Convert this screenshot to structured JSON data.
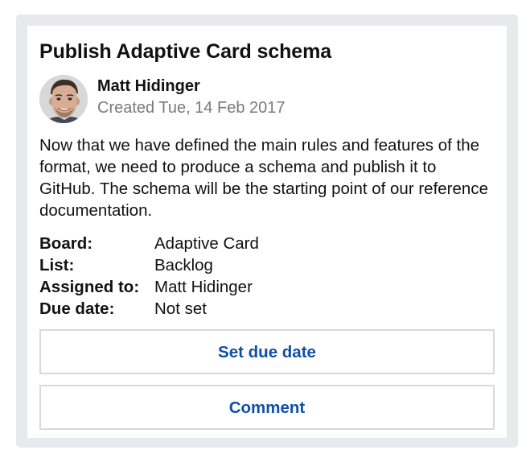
{
  "card": {
    "title": "Publish Adaptive Card schema",
    "author": {
      "name": "Matt Hidinger",
      "created": "Created Tue, 14 Feb 2017",
      "avatar_icon": "user-avatar-photo"
    },
    "description": "Now that we have defined the main rules and features of the format, we need to produce a schema and publish it to GitHub. The schema will be the starting point of our reference documentation.",
    "facts": [
      {
        "key": "Board:",
        "value": "Adaptive Card"
      },
      {
        "key": "List:",
        "value": "Backlog"
      },
      {
        "key": "Assigned to:",
        "value": "Matt Hidinger"
      },
      {
        "key": "Due date:",
        "value": "Not set"
      }
    ],
    "actions": {
      "set_due_date": "Set due date",
      "comment": "Comment"
    }
  },
  "colors": {
    "background_frame": "#e7e9ec",
    "card_background": "#ffffff",
    "action_text": "#0f4fa6",
    "secondary_text": "#7a7a7a",
    "button_border": "#d9d9d9"
  }
}
